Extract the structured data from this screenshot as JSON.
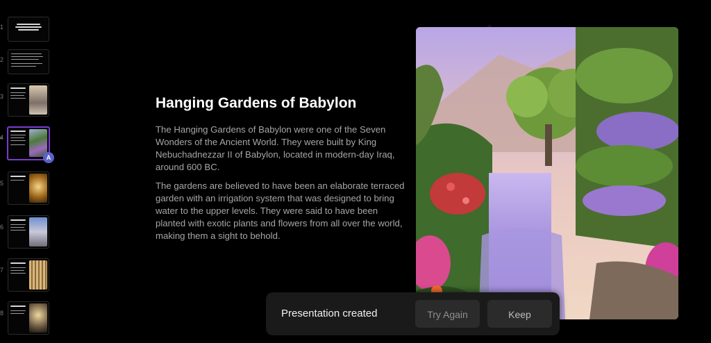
{
  "sidebar": {
    "slides": [
      {
        "number": "1",
        "image": null
      },
      {
        "number": "2",
        "image": null
      },
      {
        "number": "3",
        "image": "mountain"
      },
      {
        "number": "4",
        "image": "garden"
      },
      {
        "number": "5",
        "image": "gold"
      },
      {
        "number": "6",
        "image": "statue"
      },
      {
        "number": "7",
        "image": "temple"
      },
      {
        "number": "8",
        "image": "colossus"
      }
    ],
    "active_slide": "4",
    "collaborator_initial": "A"
  },
  "slide": {
    "title": "Hanging Gardens of Babylon",
    "paragraph1": "The Hanging Gardens of Babylon were one of the Seven Wonders of the Ancient World. They were built by King Nebuchadnezzar II of Babylon, located in modern-day Iraq, around 600 BC.",
    "paragraph2": "The gardens are believed to have been an elaborate terraced garden with an irrigation system that was designed to bring water to the upper levels. They were said to have been planted with exotic plants and flowers from all over the world, making them a sight to behold."
  },
  "toast": {
    "message": "Presentation created",
    "try_again_label": "Try Again",
    "keep_label": "Keep"
  },
  "colors": {
    "background": "#000000",
    "accent_active": "#7b3bd0",
    "avatar": "#5a63c9",
    "toast_bg": "#1a1a1a"
  }
}
